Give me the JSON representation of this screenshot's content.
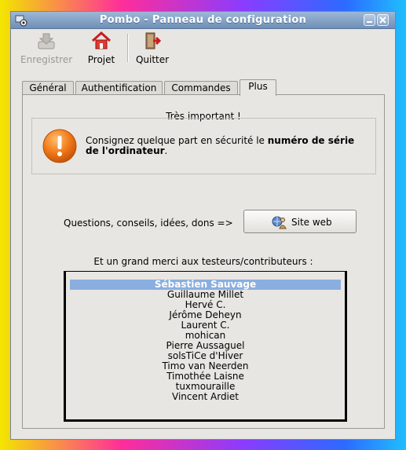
{
  "window": {
    "title": "Pombo - Panneau de configuration"
  },
  "toolbar": {
    "items": [
      {
        "label": "Enregistrer",
        "icon": "save-icon",
        "disabled": true
      },
      {
        "label": "Projet",
        "icon": "home-icon",
        "disabled": false
      },
      {
        "label": "Quitter",
        "icon": "exit-icon",
        "disabled": false
      }
    ]
  },
  "tabs": [
    {
      "label": "Général",
      "active": false
    },
    {
      "label": "Authentification",
      "active": false
    },
    {
      "label": "Commandes",
      "active": false
    },
    {
      "label": "Plus",
      "active": true
    }
  ],
  "important": {
    "title": "Très important !",
    "text_before": "Consignez quelque part en sécurité le ",
    "text_bold": "numéro de série de l'ordinateur",
    "text_after": "."
  },
  "website": {
    "prompt": "Questions, conseils, idées, dons =>",
    "button_label": "Site web"
  },
  "contributors": {
    "heading": "Et un grand merci aux testeurs/contributeurs :",
    "items": [
      "Sébastien Sauvage",
      "Guillaume Millet",
      "Hervé C.",
      "Jérôme Deheyn",
      "Laurent C.",
      "mohican",
      "Pierre Aussaguel",
      "solsTiCe d'Hiver",
      "Timo van Neerden",
      "Timothée Laisne",
      "tuxmouraille",
      "Vincent Ardiet"
    ],
    "selected_index": 0
  },
  "colors": {
    "accent": "#8aaedf",
    "titlebar": "#7f9ec4",
    "warning": "#f07a1a"
  }
}
